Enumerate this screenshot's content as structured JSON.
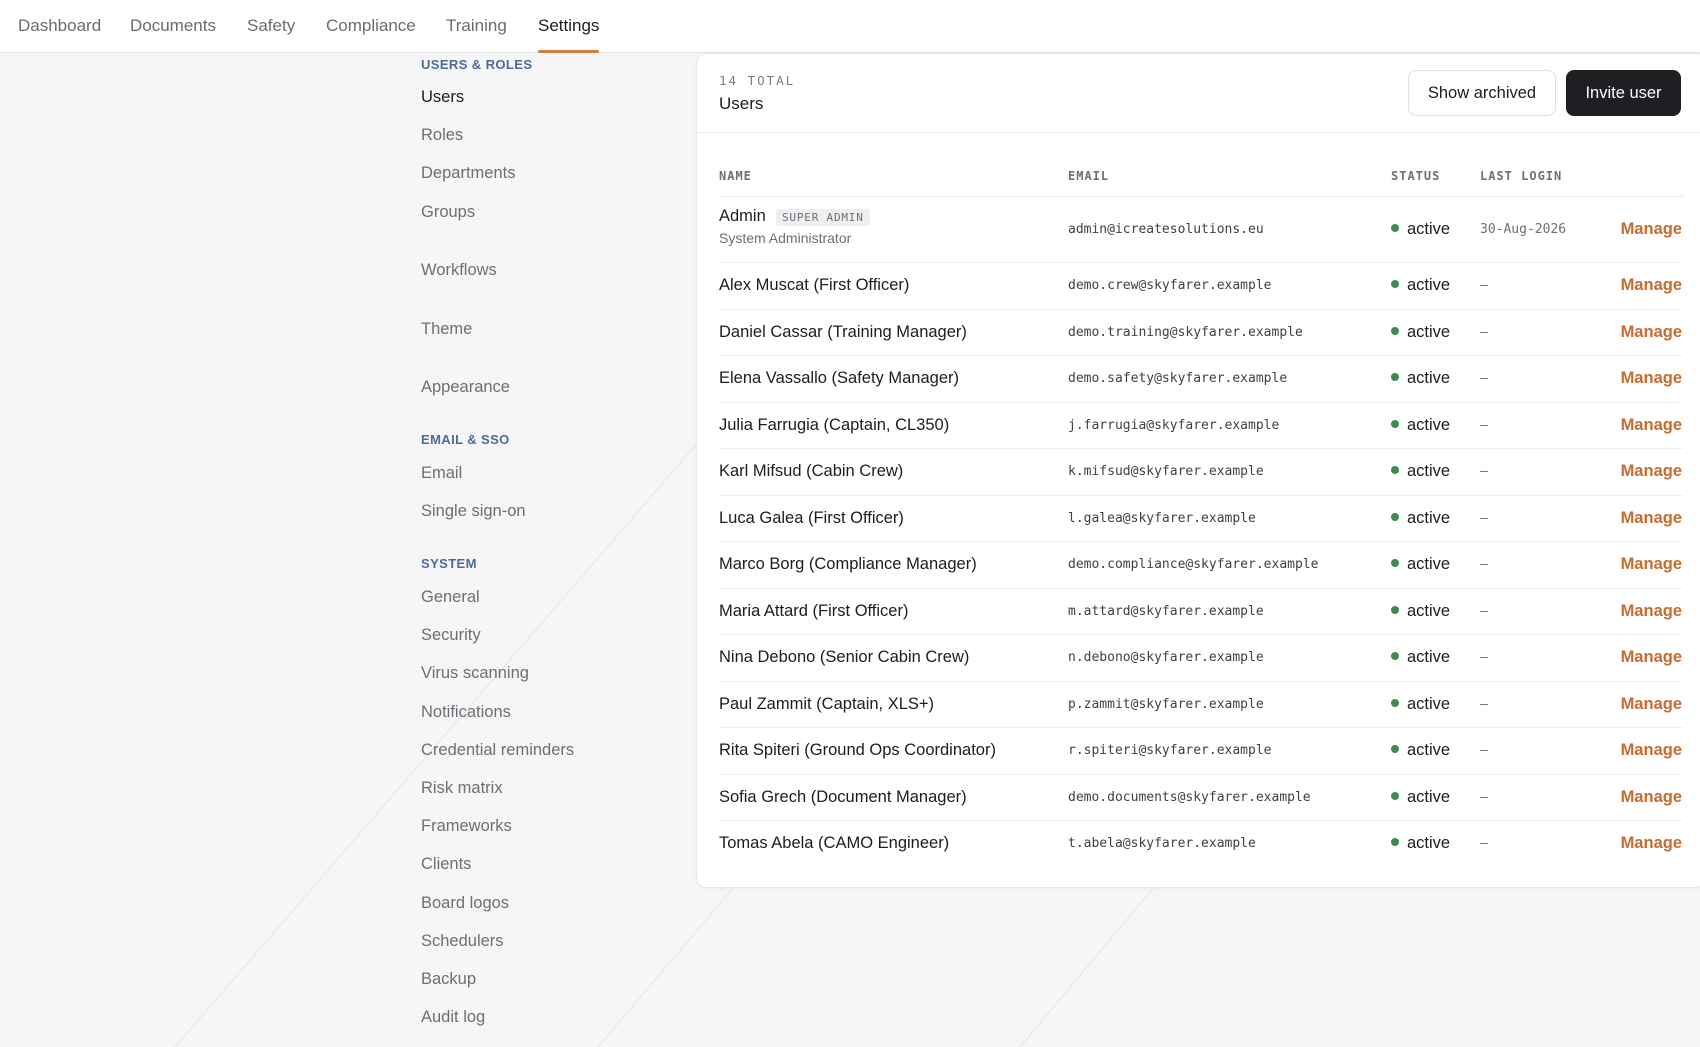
{
  "nav": {
    "tabs": [
      {
        "label": "Dashboard"
      },
      {
        "label": "Documents"
      },
      {
        "label": "Safety"
      },
      {
        "label": "Compliance"
      },
      {
        "label": "Training"
      },
      {
        "label": "Settings",
        "active": true
      }
    ]
  },
  "sidebar": {
    "users_roles_title": "USERS & ROLES",
    "users": "Users",
    "roles": "Roles",
    "departments": "Departments",
    "groups": "Groups",
    "workflows": "Workflows",
    "theme": "Theme",
    "appearance": "Appearance",
    "email_sso_title": "EMAIL & SSO",
    "email": "Email",
    "sso": "Single sign-on",
    "system_title": "SYSTEM",
    "general": "General",
    "security": "Security",
    "virus_scanning": "Virus scanning",
    "notifications": "Notifications",
    "credential_reminders": "Credential reminders",
    "risk_matrix": "Risk matrix",
    "frameworks": "Frameworks",
    "clients": "Clients",
    "board_logos": "Board logos",
    "schedulers": "Schedulers",
    "backup": "Backup",
    "audit_log": "Audit log"
  },
  "panel": {
    "count": "14 TOTAL",
    "title": "Users",
    "show_archived": "Show archived",
    "invite_user": "Invite user"
  },
  "table": {
    "columns": {
      "name": "NAME",
      "email": "EMAIL",
      "status": "STATUS",
      "last_login": "LAST LOGIN"
    },
    "rows": [
      {
        "name": "Admin",
        "badge": "SUPER ADMIN",
        "subtitle": "System Administrator",
        "email": "admin@icreatesolutions.eu",
        "status": "active",
        "last_login": "30-Aug-2026",
        "action": "Manage"
      },
      {
        "name": "Alex Muscat (First Officer)",
        "email": "demo.crew@skyfarer.example",
        "status": "active",
        "last_login": "–",
        "action": "Manage"
      },
      {
        "name": "Daniel Cassar (Training Manager)",
        "email": "demo.training@skyfarer.example",
        "status": "active",
        "last_login": "–",
        "action": "Manage"
      },
      {
        "name": "Elena Vassallo (Safety Manager)",
        "email": "demo.safety@skyfarer.example",
        "status": "active",
        "last_login": "–",
        "action": "Manage"
      },
      {
        "name": "Julia Farrugia (Captain, CL350)",
        "email": "j.farrugia@skyfarer.example",
        "status": "active",
        "last_login": "–",
        "action": "Manage"
      },
      {
        "name": "Karl Mifsud (Cabin Crew)",
        "email": "k.mifsud@skyfarer.example",
        "status": "active",
        "last_login": "–",
        "action": "Manage"
      },
      {
        "name": "Luca Galea (First Officer)",
        "email": "l.galea@skyfarer.example",
        "status": "active",
        "last_login": "–",
        "action": "Manage"
      },
      {
        "name": "Marco Borg (Compliance Manager)",
        "email": "demo.compliance@skyfarer.example",
        "status": "active",
        "last_login": "–",
        "action": "Manage"
      },
      {
        "name": "Maria Attard (First Officer)",
        "email": "m.attard@skyfarer.example",
        "status": "active",
        "last_login": "–",
        "action": "Manage"
      },
      {
        "name": "Nina Debono (Senior Cabin Crew)",
        "email": "n.debono@skyfarer.example",
        "status": "active",
        "last_login": "–",
        "action": "Manage"
      },
      {
        "name": "Paul Zammit (Captain, XLS+)",
        "email": "p.zammit@skyfarer.example",
        "status": "active",
        "last_login": "–",
        "action": "Manage"
      },
      {
        "name": "Rita Spiteri (Ground Ops Coordinator)",
        "email": "r.spiteri@skyfarer.example",
        "status": "active",
        "last_login": "–",
        "action": "Manage"
      },
      {
        "name": "Sofia Grech (Document Manager)",
        "email": "demo.documents@skyfarer.example",
        "status": "active",
        "last_login": "–",
        "action": "Manage"
      },
      {
        "name": "Tomas Abela (CAMO Engineer)",
        "email": "t.abela@skyfarer.example",
        "status": "active",
        "last_login": "–",
        "action": "Manage"
      }
    ]
  },
  "colors": {
    "accent": "#d97a3e",
    "manage_link": "#c96b2e",
    "section_title": "#4c6b9a",
    "status_active": "#3d8b4f",
    "primary_button": "#1f1f23"
  }
}
